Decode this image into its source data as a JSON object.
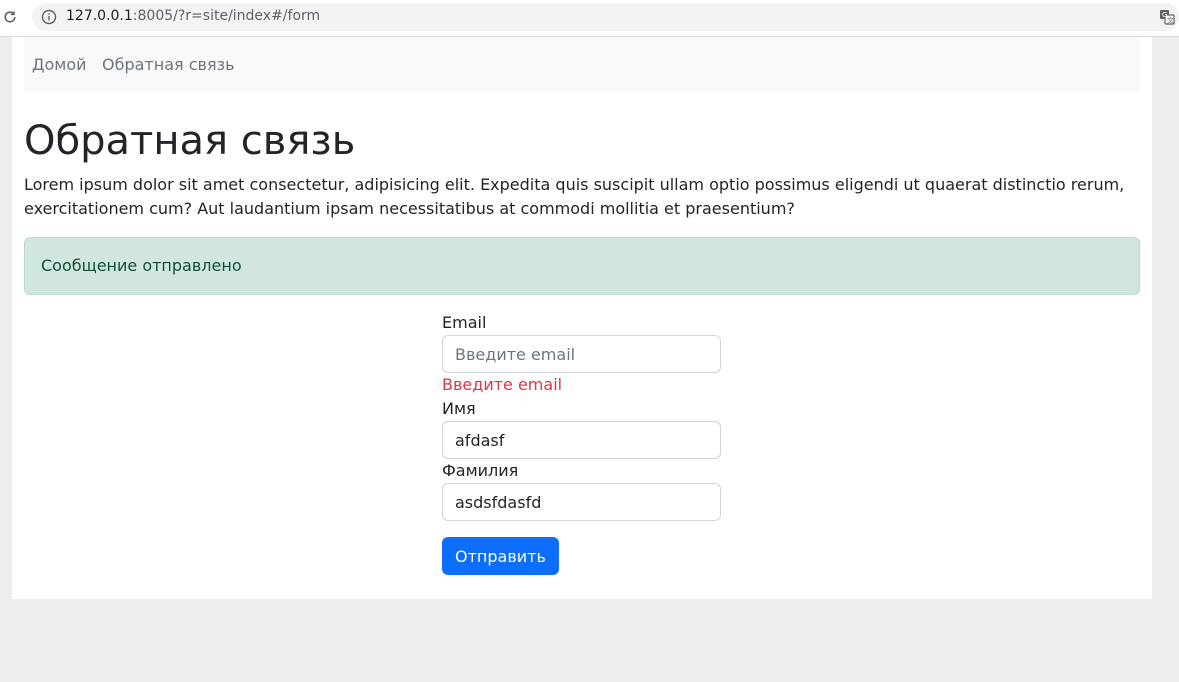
{
  "browser": {
    "url_host": "127.0.0.1",
    "url_rest": ":8005/?r=site/index#/form"
  },
  "nav": {
    "home": "Домой",
    "feedback": "Обратная связь"
  },
  "page": {
    "title": "Обратная связь",
    "intro": "Lorem ipsum dolor sit amet consectetur, adipisicing elit. Expedita quis suscipit ullam optio possimus eligendi ut quaerat distinctio rerum, exercitationem cum? Aut laudantium ipsam necessitatibus at commodi mollitia et praesentium?"
  },
  "alert": {
    "message": "Сообщение отправлено"
  },
  "form": {
    "email_label": "Email",
    "email_placeholder": "Введите email",
    "email_value": "",
    "email_error": "Введите email",
    "name_label": "Имя",
    "name_value": "afdasf",
    "surname_label": "Фамилия",
    "surname_value": "asdsfdasfd",
    "submit_label": "Отправить"
  },
  "colors": {
    "primary": "#0d6efd",
    "success_bg": "#d1e7dd",
    "success_text": "#0f5132",
    "danger": "#dc3545"
  }
}
